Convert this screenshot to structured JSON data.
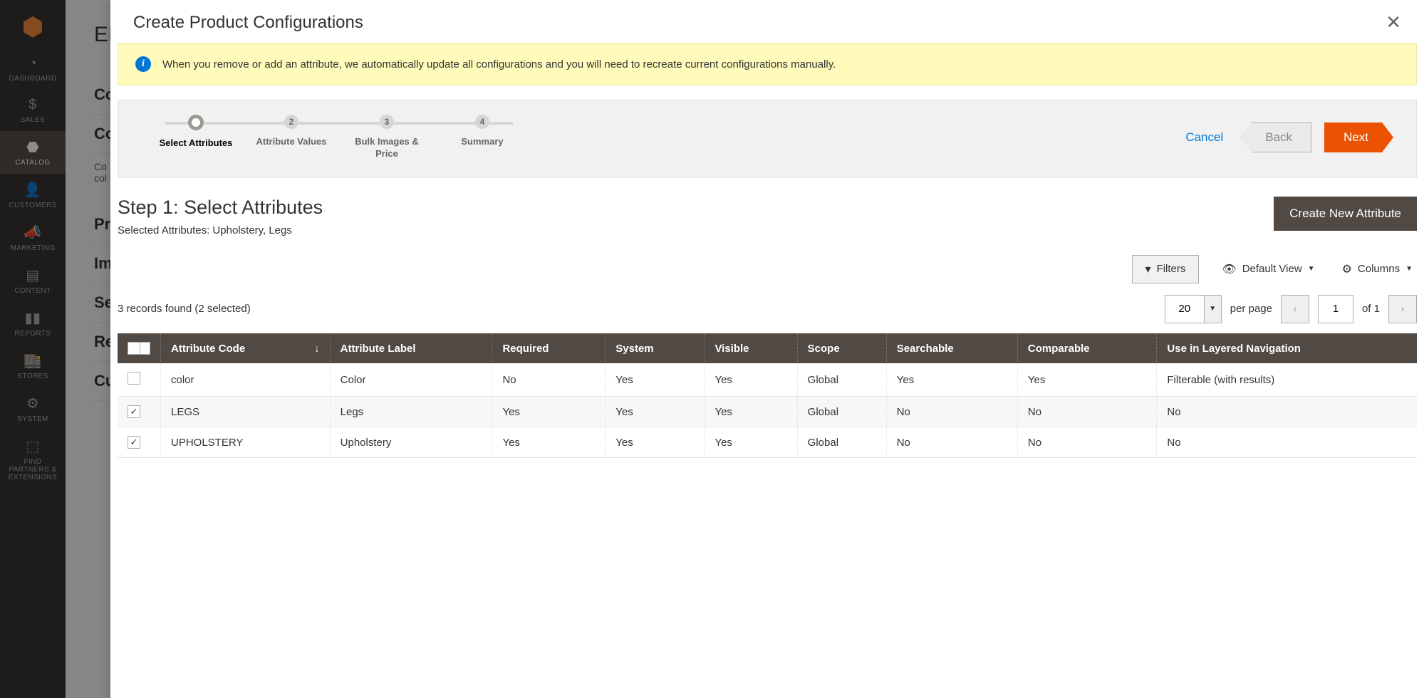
{
  "bg": {
    "page_title": "EM",
    "sections": [
      "Content",
      "Configurations",
      "Product in Websites",
      "Images And Videos",
      "Search Engine Optimization",
      "Related Products, Up-Sells, and Cross-Sells",
      "Customizable Options"
    ],
    "config_hint_l1": "Co",
    "config_hint_l2": "col"
  },
  "sidebar": [
    {
      "label": "DASHBOARD",
      "icon": "◔"
    },
    {
      "label": "SALES",
      "icon": "$"
    },
    {
      "label": "CATALOG",
      "icon": "⬣",
      "active": true
    },
    {
      "label": "CUSTOMERS",
      "icon": "👤"
    },
    {
      "label": "MARKETING",
      "icon": "📣"
    },
    {
      "label": "CONTENT",
      "icon": "▤"
    },
    {
      "label": "REPORTS",
      "icon": "▮▮"
    },
    {
      "label": "STORES",
      "icon": "🏬"
    },
    {
      "label": "SYSTEM",
      "icon": "⚙"
    },
    {
      "label": "FIND PARTNERS & EXTENSIONS",
      "icon": "⬚"
    }
  ],
  "modal": {
    "title": "Create Product Configurations",
    "notice": "When you remove or add an attribute, we automatically update all configurations and you will need to recreate current configurations manually.",
    "steps": [
      {
        "n": "1",
        "label": "Select Attributes",
        "active": true
      },
      {
        "n": "2",
        "label": "Attribute Values"
      },
      {
        "n": "3",
        "label": "Bulk Images & Price"
      },
      {
        "n": "4",
        "label": "Summary"
      }
    ],
    "actions": {
      "cancel": "Cancel",
      "back": "Back",
      "next": "Next"
    },
    "step_title": "Step 1: Select Attributes",
    "selected_attrs_label": "Selected Attributes: ",
    "selected_attrs_value": "Upholstery, Legs",
    "create_attr": "Create New Attribute",
    "toolbar": {
      "filters": "Filters",
      "default_view": "Default View",
      "columns": "Columns"
    },
    "records": "3 records found (2 selected)",
    "pager": {
      "page_size": "20",
      "per_page": "per page",
      "page": "1",
      "of_label": "of 1"
    },
    "columns": [
      "Attribute Code",
      "Attribute Label",
      "Required",
      "System",
      "Visible",
      "Scope",
      "Searchable",
      "Comparable",
      "Use in Layered Navigation"
    ],
    "rows": [
      {
        "checked": false,
        "code": "color",
        "label": "Color",
        "required": "No",
        "system": "Yes",
        "visible": "Yes",
        "scope": "Global",
        "searchable": "Yes",
        "comparable": "Yes",
        "layered": "Filterable (with results)"
      },
      {
        "checked": true,
        "code": "LEGS",
        "label": "Legs",
        "required": "Yes",
        "system": "Yes",
        "visible": "Yes",
        "scope": "Global",
        "searchable": "No",
        "comparable": "No",
        "layered": "No"
      },
      {
        "checked": true,
        "code": "UPHOLSTERY",
        "label": "Upholstery",
        "required": "Yes",
        "system": "Yes",
        "visible": "Yes",
        "scope": "Global",
        "searchable": "No",
        "comparable": "No",
        "layered": "No"
      }
    ]
  }
}
